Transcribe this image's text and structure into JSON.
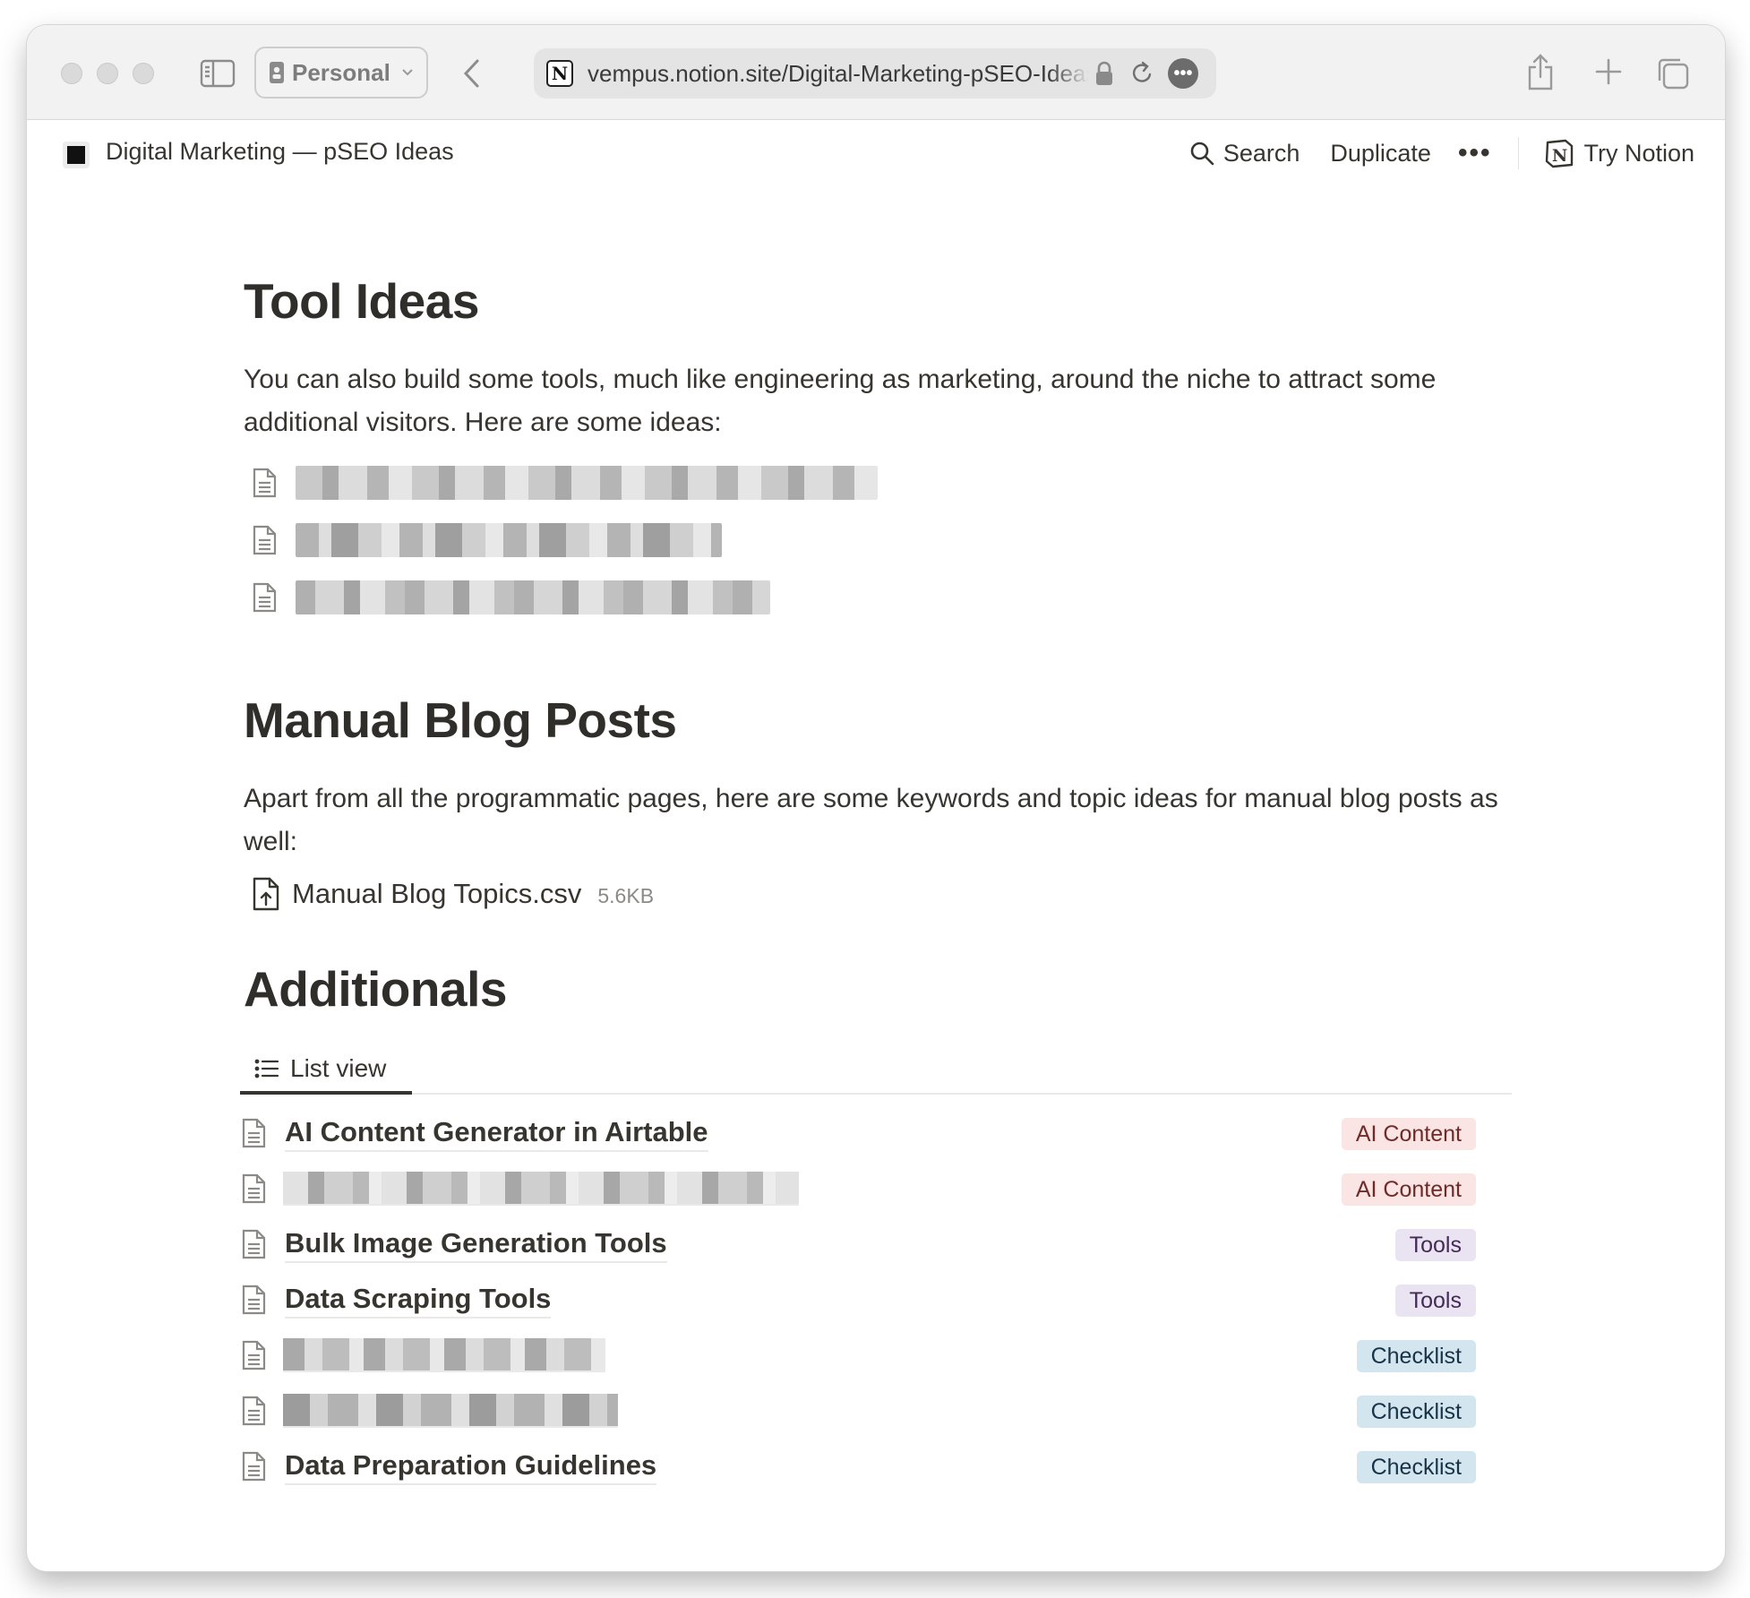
{
  "browser": {
    "profile_label": "Personal",
    "url": "vempus.notion.site/Digital-Marketing-pSEO-Ideas"
  },
  "notion_topbar": {
    "breadcrumb": "Digital Marketing — pSEO Ideas",
    "search_label": "Search",
    "duplicate_label": "Duplicate",
    "more_label": "•••",
    "try_notion_label": "Try Notion"
  },
  "tool_ideas": {
    "heading": "Tool Ideas",
    "description": "You can also build some tools, much like engineering as marketing, around the niche to attract some additional visitors. Here are some ideas:"
  },
  "manual_blog_posts": {
    "heading": "Manual Blog Posts",
    "description": "Apart from all the programmatic pages, here are some keywords and topic ideas for manual blog posts as well:",
    "file": {
      "name": "Manual Blog Topics.csv",
      "size": "5.6KB"
    }
  },
  "additionals": {
    "heading": "Additionals",
    "view_tab_label": "List view",
    "items": [
      {
        "title": "AI Content Generator in Airtable",
        "tag": "AI Content"
      },
      {
        "title": "",
        "tag": "AI Content"
      },
      {
        "title": "Bulk Image Generation Tools",
        "tag": "Tools"
      },
      {
        "title": "Data Scraping Tools",
        "tag": "Tools"
      },
      {
        "title": "",
        "tag": "Checklist"
      },
      {
        "title": "",
        "tag": "Checklist"
      },
      {
        "title": "Data Preparation Guidelines",
        "tag": "Checklist"
      }
    ]
  },
  "colors": {
    "tag_ai_content_bg": "#fbe4e4",
    "tag_ai_content_text": "#6f2b27",
    "tag_tools_bg": "#eae4f2",
    "tag_tools_text": "#432a57",
    "tag_checklist_bg": "#d3e5ef",
    "tag_checklist_text": "#183347"
  },
  "icons": {
    "sidebar": "sidebar-icon",
    "back": "chevron-left-icon",
    "lock": "lock-icon",
    "reload": "reload-icon",
    "share": "share-icon",
    "new_tab": "plus-icon",
    "tab_overview": "tabs-icon",
    "search": "search-icon",
    "page": "page-icon",
    "file_upload": "file-upload-icon",
    "list": "list-icon"
  }
}
